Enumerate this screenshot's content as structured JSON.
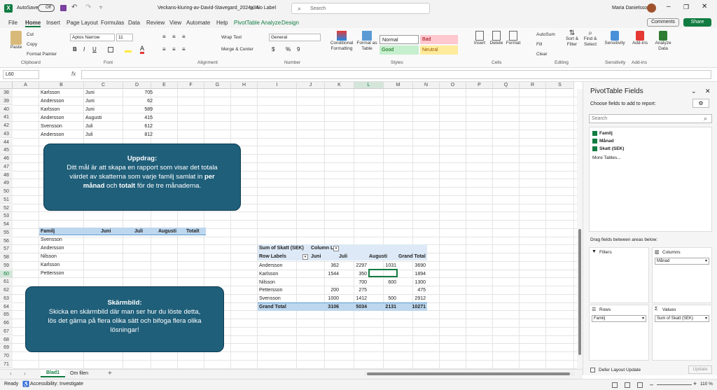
{
  "titlebar": {
    "autosave_label": "AutoSave",
    "autosave_state": "Off",
    "filename": "Veckans-kluring-av-David-Stavegard_2024v34",
    "label_status": "No Label",
    "search_placeholder": "Search",
    "user": "Maria Danielsson"
  },
  "menu_tabs": [
    "File",
    "Home",
    "Insert",
    "Page Layout",
    "Formulas",
    "Data",
    "Review",
    "View",
    "Automate",
    "Help",
    "PivotTable Analyze",
    "Design"
  ],
  "comments_label": "Comments",
  "share_label": "Share",
  "ribbon": {
    "paste": "Paste",
    "cut": "Cut",
    "copy": "Copy",
    "format_painter": "Format Painter",
    "clipboard": "Clipboard",
    "font_name": "Aptos Narrow",
    "font_size": "11",
    "font": "Font",
    "wrap_text": "Wrap Text",
    "merge_center": "Merge & Center",
    "alignment": "Alignment",
    "number_format": "General",
    "number": "Number",
    "conditional_formatting": "Conditional Formatting",
    "format_as_table": "Format as Table",
    "style_normal": "Normal",
    "style_bad": "Bad",
    "style_good": "Good",
    "style_neutral": "Neutral",
    "styles": "Styles",
    "insert": "Insert",
    "delete": "Delete",
    "format": "Format",
    "cells": "Cells",
    "autosum": "AutoSum",
    "fill": "Fill",
    "clear": "Clear",
    "sort_filter": "Sort & Filter",
    "find_select": "Find & Select",
    "editing": "Editing",
    "sensitivity": "Sensitivity",
    "addins": "Add-ins",
    "analyze_data": "Analyze Data"
  },
  "namebox": "L60",
  "columns": [
    "A",
    "B",
    "C",
    "D",
    "E",
    "F",
    "G",
    "H",
    "I",
    "J",
    "K",
    "L",
    "M",
    "N",
    "O",
    "P",
    "Q",
    "R",
    "S"
  ],
  "rows": [
    "38",
    "39",
    "40",
    "41",
    "42",
    "43",
    "44",
    "45",
    "46",
    "47",
    "48",
    "49",
    "50",
    "51",
    "52",
    "53",
    "54",
    "55",
    "56",
    "57",
    "58",
    "59",
    "60",
    "61",
    "62",
    "63",
    "64",
    "65",
    "66",
    "67",
    "68",
    "69",
    "70",
    "71"
  ],
  "top_data": [
    {
      "name": "Karlsson",
      "month": "Juni",
      "value": "705"
    },
    {
      "name": "Andersson",
      "month": "Juni",
      "value": "62"
    },
    {
      "name": "Karlsson",
      "month": "Juni",
      "value": "589"
    },
    {
      "name": "Andersson",
      "month": "Augusti",
      "value": "415"
    },
    {
      "name": "Svensson",
      "month": "Juli",
      "value": "612"
    },
    {
      "name": "Andersson",
      "month": "Juli",
      "value": "812"
    }
  ],
  "callout1": {
    "title": "Uppdrag:",
    "line1": "Ditt mål är att skapa en rapport som visar det totala",
    "line2": "värdet av skatterna som varje familj samlat in",
    "bold1": "per",
    "bold2": "månad",
    "mid": "och",
    "bold3": "totalt",
    "end": "för de tre månaderna."
  },
  "callout2": {
    "title": "Skärmbild:",
    "line1": "Skicka en skärmbild där man ser hur du löste detta,",
    "line2": "lös det gärna på flera olika sätt och bifoga flera olika",
    "line3": "lösningar!"
  },
  "report": {
    "headers": [
      "Familj",
      "Juni",
      "Juli",
      "Augusti",
      "Totalt"
    ],
    "families": [
      "Svensson",
      "Andersson",
      "Nilsson",
      "Karlsson",
      "Pettersson"
    ]
  },
  "pivot": {
    "corner": "Sum of Skatt (SEK)",
    "col_label": "Column L",
    "row_label": "Row Labels",
    "months": [
      "Juni",
      "Juli",
      "Augusti",
      "Grand Total"
    ],
    "rows": [
      {
        "name": "Andersson",
        "v": [
          "362",
          "2297",
          "1031",
          "3690"
        ]
      },
      {
        "name": "Karlsson",
        "v": [
          "1544",
          "350",
          "",
          "1894"
        ]
      },
      {
        "name": "Nilsson",
        "v": [
          "",
          "700",
          "600",
          "1300"
        ]
      },
      {
        "name": "Pettersson",
        "v": [
          "200",
          "275",
          "",
          "475"
        ]
      },
      {
        "name": "Svensson",
        "v": [
          "1000",
          "1412",
          "500",
          "2912"
        ]
      }
    ],
    "total": {
      "name": "Grand Total",
      "v": [
        "3106",
        "5034",
        "2131",
        "10271"
      ]
    }
  },
  "pane": {
    "title": "PivotTable Fields",
    "choose": "Choose fields to add to report:",
    "search": "Search",
    "fields": [
      "Familj",
      "Månad",
      "Skatt (SEK)"
    ],
    "more": "More Tables...",
    "drag": "Drag fields between areas below:",
    "filters": "Filters",
    "columns": "Columns",
    "rows": "Rows",
    "values": "Values",
    "col_item": "Månad",
    "row_item": "Familj",
    "val_item": "Sum of Skatt (SEK)",
    "defer": "Defer Layout Update",
    "update": "Update"
  },
  "sheets": [
    "Blad1",
    "Om filen"
  ],
  "status": {
    "ready": "Ready",
    "accessibility": "Accessibility: Investigate",
    "zoom": "110 %"
  },
  "colors": {
    "accent": "#107c41",
    "callout": "#1f5f7a",
    "pivot_header": "#bdd7ee"
  }
}
